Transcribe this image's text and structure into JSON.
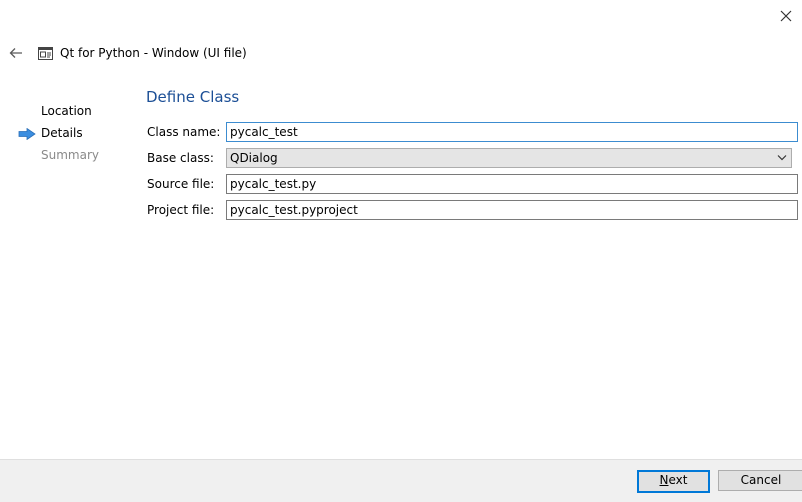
{
  "window": {
    "title": "Qt for Python - Window (UI file)",
    "close_icon": "close-icon",
    "back_icon": "back-arrow-icon"
  },
  "steps": [
    {
      "label": "Location",
      "state": "done"
    },
    {
      "label": "Details",
      "state": "current"
    },
    {
      "label": "Summary",
      "state": "pending"
    }
  ],
  "form": {
    "title": "Define Class",
    "class_name": {
      "label": "Class name:",
      "value": "pycalc_test"
    },
    "base_class": {
      "label": "Base class:",
      "value": "QDialog"
    },
    "source_file": {
      "label": "Source file:",
      "value": "pycalc_test.py"
    },
    "project_file": {
      "label": "Project file:",
      "value": "pycalc_test.pyproject"
    }
  },
  "buttons": {
    "next_label": "Next",
    "next_mnemonic": "N",
    "next_rest": "ext",
    "cancel_label": "Cancel"
  },
  "colors": {
    "accent": "#1c4f96",
    "focus": "#0078d7",
    "arrow": "#3b8ee0"
  }
}
